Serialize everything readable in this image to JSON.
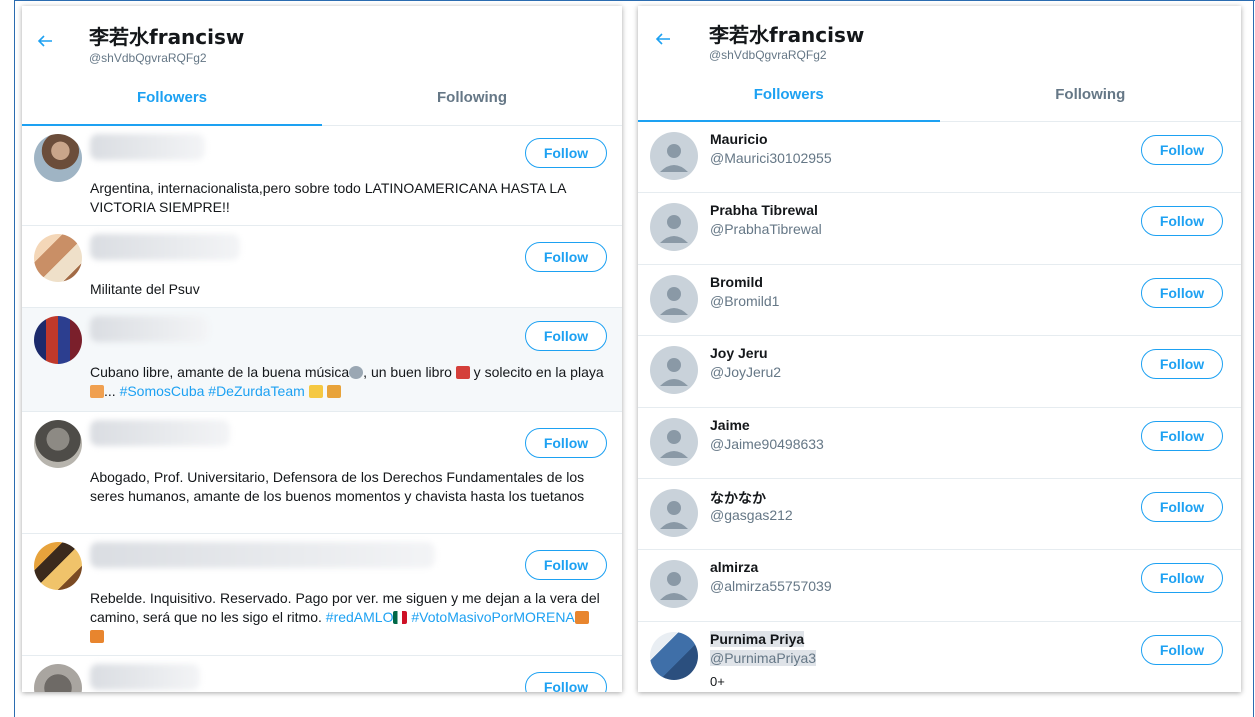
{
  "left_panel": {
    "title": "李若水francisw",
    "handle": "@shVdbQgvraRQFg2",
    "tabs": [
      {
        "label": "Followers"
      },
      {
        "label": "Following"
      }
    ],
    "follow_label": "Follow",
    "items": [
      {
        "bio": "Argentina, internacionalista,pero sobre todo LATINOAMERICANA HASTA LA VICTORIA SIEMPRE!!"
      },
      {
        "bio": "Militante del Psuv"
      },
      {
        "bio_a": "Cubano libre, amante de la buena música",
        "bio_b": ", un buen libro",
        "bio_c": " y solecito en la playa",
        "bio_d": "... ",
        "bio_tags": "#SomosCuba #DeZurdaTeam"
      },
      {
        "bio": "Abogado, Prof. Universitario, Defensora de los Derechos Fundamentales de los seres humanos, amante de los buenos momentos y chavista hasta los tuetanos"
      },
      {
        "bio_a": "Rebelde. Inquisitivo. Reservado. Pago por ver. me siguen y me dejan a la vera del camino, será que no les sigo el ritmo. ",
        "tag1": "#redAMLO",
        "tag2": "#VotoMasivoPorMORENA"
      },
      {
        "bio": ""
      }
    ]
  },
  "right_panel": {
    "title": "李若水francisw",
    "handle": "@shVdbQgvraRQFg2",
    "tabs": [
      {
        "label": "Followers"
      },
      {
        "label": "Following"
      }
    ],
    "follow_label": "Follow",
    "users": [
      {
        "name": "Mauricio",
        "handle": "@Maurici30102955"
      },
      {
        "name": "Prabha Tibrewal",
        "handle": "@PrabhaTibrewal"
      },
      {
        "name": "Bromild",
        "handle": "@Bromild1"
      },
      {
        "name": "Joy Jeru",
        "handle": "@JoyJeru2"
      },
      {
        "name": "Jaime",
        "handle": "@Jaime90498633"
      },
      {
        "name": "なかなか",
        "handle": "@gasgas212"
      },
      {
        "name": "almirza",
        "handle": "@almirza55757039"
      },
      {
        "name": "Purnima Priya",
        "handle": "@PurnimaPriya3",
        "bio": "0+"
      }
    ]
  },
  "colors": {
    "accent": "#1da1f2",
    "muted": "#657786",
    "border": "#e6ecf0"
  }
}
